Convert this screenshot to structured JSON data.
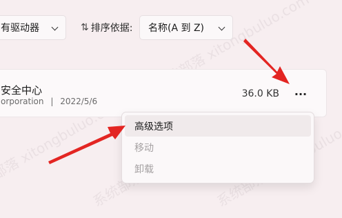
{
  "toolbar": {
    "filter_value": "有驱动器",
    "sort_label": "排序依据:",
    "sort_value": "名称(A 到 Z)"
  },
  "app_row": {
    "name": "安全中心",
    "publisher": "orporation",
    "separator": "|",
    "date": "2022/5/6",
    "size": "36.0 KB",
    "more_label": "···"
  },
  "context_menu": {
    "items": [
      {
        "label": "高级选项",
        "state": "active"
      },
      {
        "label": "移动",
        "state": "disabled"
      },
      {
        "label": "卸载",
        "state": "disabled"
      }
    ]
  },
  "watermark": {
    "text": "系统部落 xitongbuluo.com"
  },
  "colors": {
    "background": "#f7eef0",
    "arrow": "#e32522"
  }
}
